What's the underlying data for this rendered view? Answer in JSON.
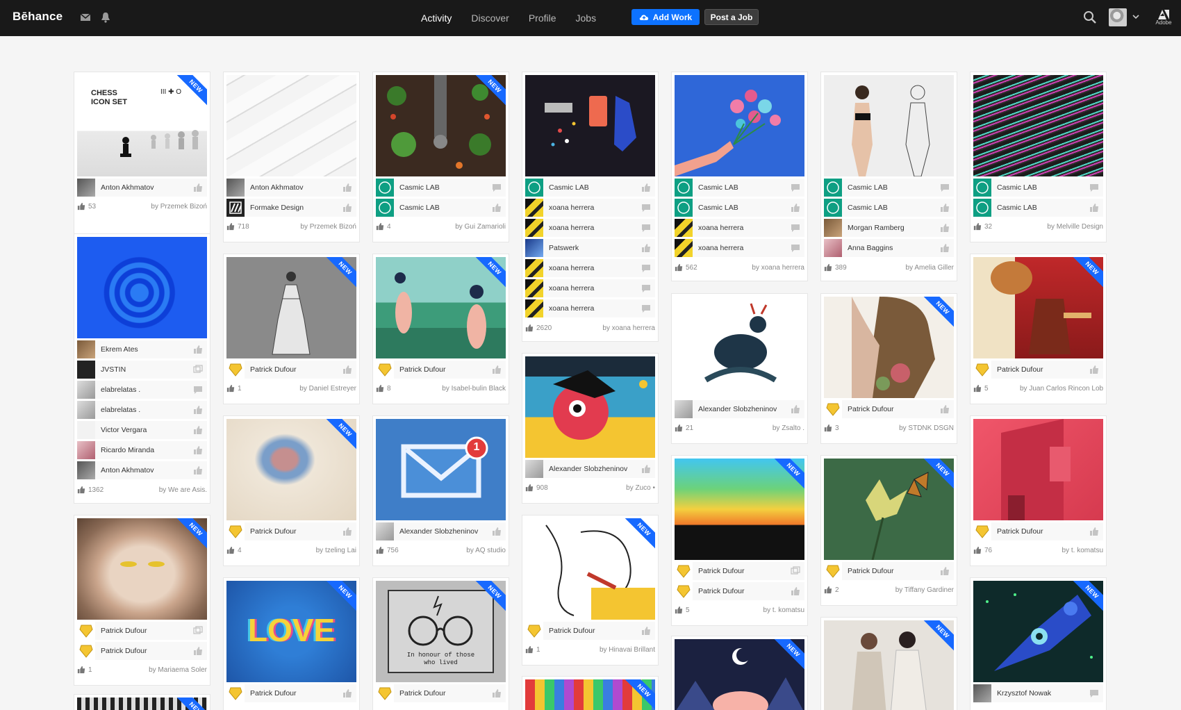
{
  "brand": "Bēhance",
  "nav": {
    "activity": "Activity",
    "discover": "Discover",
    "profile": "Profile",
    "jobs": "Jobs"
  },
  "buttons": {
    "add_work": "Add Work",
    "post_job": "Post a Job"
  },
  "adobe_label": "Adobe",
  "badge_new": "NEW",
  "colors": {
    "topbar": "#191919",
    "accent": "#0d72ff",
    "new_badge": "#1769ff"
  },
  "cards": {
    "c1": {
      "thumb_title": "CHESS\nICON SET",
      "thumb_icons": "III ✚ O",
      "rows": [
        "Anton Akhmatov"
      ],
      "likes": "53",
      "by": "by  Przemek Bizoń"
    },
    "c2": {
      "rows": [
        "Ekrem Ates",
        "JVSTIN",
        "elabrelatas .",
        "elabrelatas .",
        "Victor Vergara",
        "Ricardo Miranda",
        "Anton Akhmatov"
      ],
      "likes": "1362",
      "by": "by  We are Asis."
    },
    "c3": {
      "rows": [
        "Patrick Dufour",
        "Patrick Dufour"
      ],
      "likes": "1",
      "by": "by  Mariaema Soler"
    },
    "c4": {
      "rows": [
        "Anton Akhmatov",
        "Formake Design"
      ],
      "likes": "718",
      "by": "by  Przemek Bizoń"
    },
    "c5": {
      "rows": [
        "Patrick Dufour"
      ],
      "likes": "1",
      "by": "by  Daniel Estreyer"
    },
    "c6": {
      "rows": [
        "Patrick Dufour"
      ],
      "likes": "4",
      "by": "by  tzeling Lai"
    },
    "c7": {
      "thumb_text": "LOVE",
      "rows": [
        "Patrick Dufour"
      ]
    },
    "c8": {
      "rows": [
        "Casmic LAB",
        "Casmic LAB"
      ],
      "likes": "4",
      "by": "by  Gui Zamarioli"
    },
    "c9": {
      "rows": [
        "Patrick Dufour"
      ],
      "likes": "8",
      "by": "by  Isabel-bulin Black"
    },
    "c10": {
      "notif": "1",
      "rows": [
        "Alexander Slobzheninov"
      ],
      "likes": "756",
      "by": "by  AQ studio"
    },
    "c11": {
      "thumb_text": "In honour of those\nwho lived",
      "rows": [
        "Patrick Dufour"
      ]
    },
    "c12": {
      "rows": [
        "Casmic LAB",
        "xoana herrera",
        "xoana herrera",
        "Patswerk",
        "xoana herrera",
        "xoana herrera",
        "xoana herrera"
      ],
      "likes": "2620",
      "by": "by  xoana herrera"
    },
    "c13": {
      "rows": [
        "Alexander Slobzheninov"
      ],
      "likes": "908",
      "by": "by  Zuco •"
    },
    "c14": {
      "rows": [
        "Patrick Dufour"
      ],
      "likes": "1",
      "by": "by  Hinavai Brillant"
    },
    "c15": {},
    "c16": {
      "rows": [
        "Casmic LAB",
        "Casmic LAB",
        "xoana herrera",
        "xoana herrera"
      ],
      "likes": "562",
      "by": "by  xoana herrera"
    },
    "c17": {
      "rows": [
        "Alexander Slobzheninov"
      ],
      "likes": "21",
      "by": "by  Zsalto ."
    },
    "c18": {
      "rows": [
        "Patrick Dufour",
        "Patrick Dufour"
      ],
      "likes": "5",
      "by": "by  t. komatsu"
    },
    "c19": {},
    "c20": {
      "rows": [
        "Casmic LAB",
        "Casmic LAB",
        "Morgan Ramberg",
        "Anna Baggins"
      ],
      "likes": "389",
      "by": "by  Amelia Giller"
    },
    "c21": {
      "rows": [
        "Patrick Dufour"
      ],
      "likes": "3",
      "by": "by  STDNK DSGN"
    },
    "c22": {
      "rows": [
        "Patrick Dufour"
      ],
      "likes": "2",
      "by": "by  Tiffany Gardiner"
    },
    "c23": {},
    "c24": {
      "rows": [
        "Casmic LAB",
        "Casmic LAB"
      ],
      "likes": "32",
      "by": "by  Melville Design"
    },
    "c25": {
      "rows": [
        "Patrick Dufour"
      ],
      "likes": "5",
      "by": "by  Juan Carlos Rincon Lobo"
    },
    "c26": {
      "rows": [
        "Patrick Dufour"
      ],
      "likes": "76",
      "by": "by  t. komatsu"
    },
    "c27": {
      "rows": [
        "Krzysztof Nowak"
      ]
    }
  }
}
